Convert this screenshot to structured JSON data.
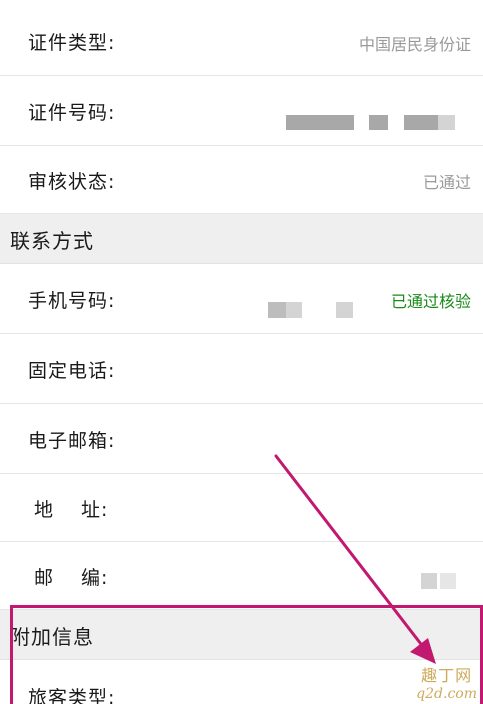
{
  "rows": {
    "id_type": {
      "label": "证件类型:",
      "value": "中国居民身份证"
    },
    "id_number": {
      "label": "证件号码:"
    },
    "review_status": {
      "label": "审核状态:",
      "value": "已通过"
    },
    "mobile": {
      "label": "手机号码:",
      "value": "已通过核验"
    },
    "landline": {
      "label": "固定电话:"
    },
    "email": {
      "label": "电子邮箱:"
    },
    "address": {
      "label": "地　 址:"
    },
    "postcode": {
      "label": "邮　 编:"
    },
    "passenger_type": {
      "label": "旅客类型:"
    }
  },
  "sections": {
    "contact": "联系方式",
    "additional": "附加信息"
  },
  "annotation": {
    "color": "#c2186f"
  },
  "watermark": {
    "line1": "趣丁网",
    "line2": "q2d.com"
  },
  "colors": {
    "verified_green": "#1a8a1a",
    "muted_value": "#9a9a9a",
    "section_bg": "#efefef"
  }
}
